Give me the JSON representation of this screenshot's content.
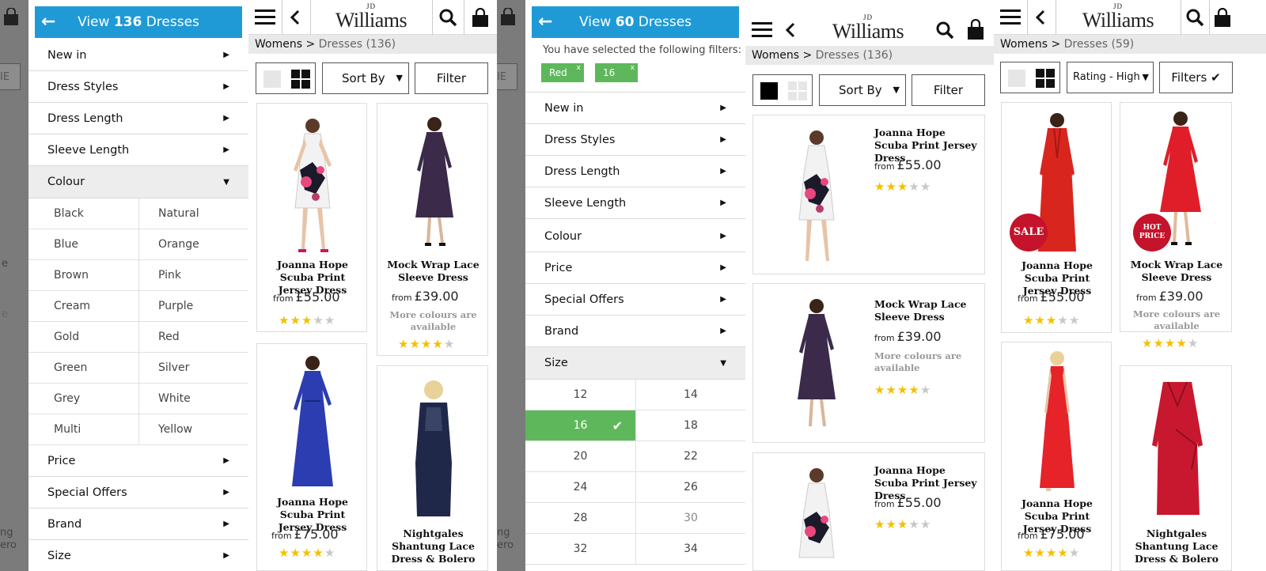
{
  "colors": {
    "accent": "#1f9ad6",
    "selected_green": "#5fb75c",
    "star": "#f4c000",
    "badge": "#c4132a"
  },
  "screen1": {
    "gray": {
      "label_stub": "IE",
      "text_stub": "e",
      "text_stub2": "e",
      "bottom_stub1": "ng",
      "bottom_stub2": "ero"
    },
    "header": {
      "back_icon": "arrow-left-icon",
      "prefix": "View ",
      "count": "136",
      "suffix": " Dresses"
    },
    "menu": [
      {
        "label": "New in"
      },
      {
        "label": "Dress Styles"
      },
      {
        "label": "Dress Length"
      },
      {
        "label": "Sleeve Length"
      }
    ],
    "open_menu": {
      "label": "Colour"
    },
    "colours": [
      [
        "Black",
        "Natural"
      ],
      [
        "Blue",
        "Orange"
      ],
      [
        "Brown",
        "Pink"
      ],
      [
        "Cream",
        "Purple"
      ],
      [
        "Gold",
        "Red"
      ],
      [
        "Green",
        "Silver"
      ],
      [
        "Grey",
        "White"
      ],
      [
        "Multi",
        "Yellow"
      ]
    ],
    "menu_after": [
      {
        "label": "Price"
      },
      {
        "label": "Special Offers"
      },
      {
        "label": "Brand"
      },
      {
        "label": "Size"
      }
    ]
  },
  "screen2": {
    "logo_jd": "JD",
    "logo_name": "Williams",
    "breadcrumb": {
      "root": "Womens",
      "sep": " > ",
      "current": "Dresses (136)"
    },
    "sort_label": "Sort By",
    "filter_label": "Filter",
    "products": [
      {
        "name": "Joanna Hope Scuba Print Jersey Dress",
        "from": "from",
        "price": "£55.00",
        "rating": 3,
        "more": ""
      },
      {
        "name": "Mock Wrap Lace Sleeve Dress",
        "from": "from",
        "price": "£39.00",
        "rating": 4,
        "more": "More colours are available"
      },
      {
        "name": "Joanna Hope Scuba Print Jersey Dress",
        "from": "from",
        "price": "£75.00",
        "rating": 4,
        "more": ""
      },
      {
        "name": "Nightgales Shantung Lace Dress & Bolero",
        "from": "",
        "price": "",
        "rating": 0,
        "more": ""
      }
    ]
  },
  "screen3": {
    "gray": {
      "label_stub": "IE",
      "bottom_stub1": "ng",
      "bottom_stub2": "ero"
    },
    "header": {
      "prefix": "View ",
      "count": "60",
      "suffix": " Dresses"
    },
    "selected_text": "You have selected the following filters:",
    "chips": [
      {
        "label": "Red",
        "x": "x"
      },
      {
        "label": "16",
        "x": "x"
      }
    ],
    "menu": [
      {
        "label": "New in"
      },
      {
        "label": "Dress Styles"
      },
      {
        "label": "Dress Length"
      },
      {
        "label": "Sleeve Length"
      },
      {
        "label": "Colour"
      },
      {
        "label": "Price"
      },
      {
        "label": "Special Offers"
      },
      {
        "label": "Brand"
      }
    ],
    "open_menu": {
      "label": "Size"
    },
    "sizes": [
      [
        "12",
        "14"
      ],
      [
        "16",
        "18"
      ],
      [
        "20",
        "22"
      ],
      [
        "24",
        "26"
      ],
      [
        "28",
        "30"
      ],
      [
        "32",
        "34"
      ]
    ],
    "selected_size": "16"
  },
  "screen4": {
    "logo_jd": "JD",
    "logo_name": "Williams",
    "breadcrumb": {
      "root": "Womens",
      "sep": " > ",
      "current": "Dresses (136)"
    },
    "sort_label": "Sort By",
    "filter_label": "Filter",
    "products": [
      {
        "name": "Joanna Hope Scuba Print Jersey Dress",
        "from": "from",
        "price": "£55.00",
        "rating": 3,
        "more": ""
      },
      {
        "name": "Mock Wrap Lace Sleeve Dress",
        "from": "from",
        "price": "£39.00",
        "rating": 4,
        "more": "More colours are available"
      },
      {
        "name": "Joanna Hope Scuba Print Jersey Dress",
        "from": "from",
        "price": "£55.00",
        "rating": 3,
        "more": ""
      }
    ]
  },
  "screen5": {
    "logo_jd": "JD",
    "logo_name": "Williams",
    "breadcrumb": {
      "root": "Womens",
      "sep": " > ",
      "current": "Dresses (59)"
    },
    "sort_label": "Rating - High",
    "filter_label": "Filters",
    "badges": [
      "SALE",
      "HOT PRICE"
    ],
    "products": [
      {
        "name": "Joanna Hope Scuba Print Jersey Dress",
        "from": "from",
        "price": "£55.00",
        "rating": 3,
        "more": ""
      },
      {
        "name": "Mock Wrap Lace Sleeve Dress",
        "from": "from",
        "price": "£39.00",
        "rating": 4,
        "more": "More colours are available"
      },
      {
        "name": "Joanna Hope Scuba Print Jersey Dress",
        "from": "from",
        "price": "£75.00",
        "rating": 4,
        "more": ""
      },
      {
        "name": "Nightgales Shantung Lace Dress & Bolero",
        "from": "",
        "price": "",
        "rating": 0,
        "more": ""
      }
    ]
  }
}
